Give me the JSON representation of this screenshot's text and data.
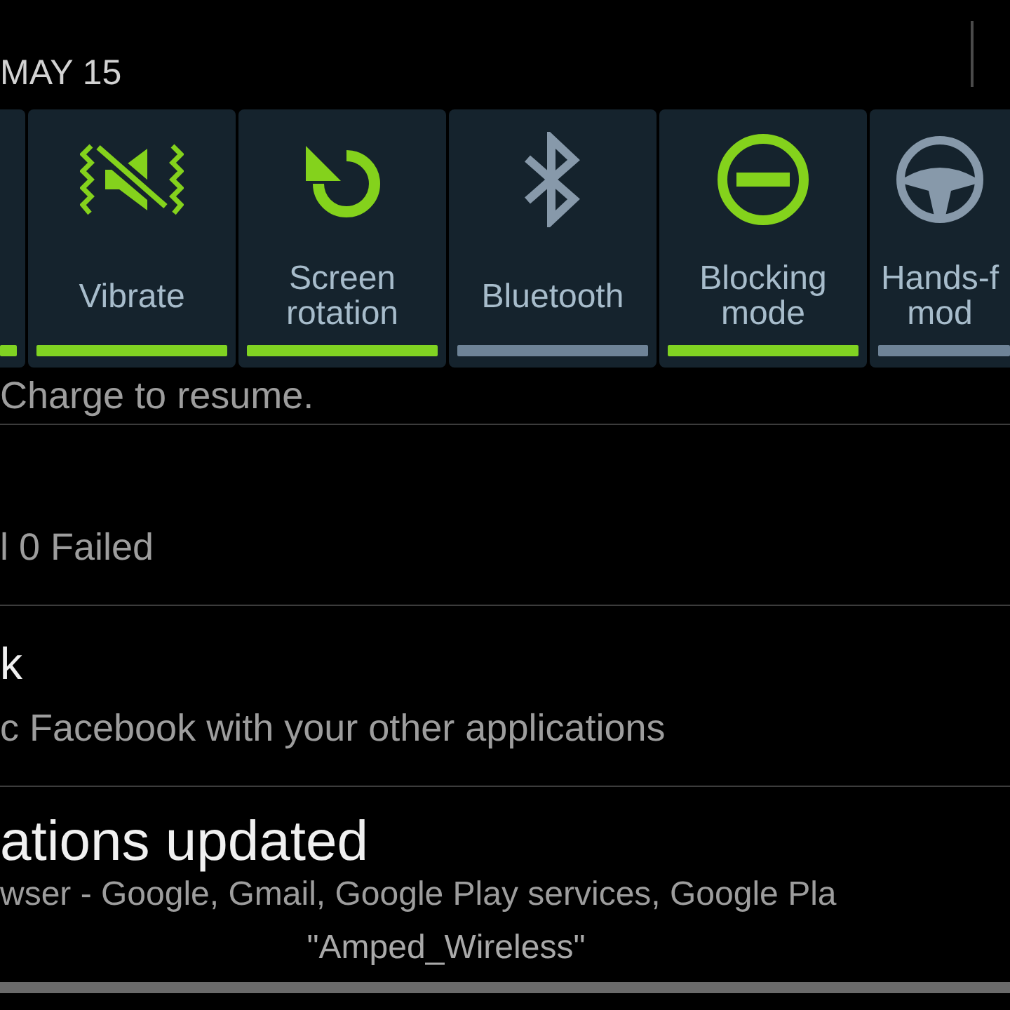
{
  "header": {
    "date": "MAY 15"
  },
  "quick_settings": [
    {
      "on": true
    },
    {
      "kind": "vibrate",
      "label": "Vibrate",
      "on": true
    },
    {
      "kind": "rotation",
      "label": "Screen rotation",
      "on": true
    },
    {
      "kind": "bluetooth",
      "label": "Bluetooth",
      "on": false
    },
    {
      "kind": "blocking",
      "label": "Blocking mode",
      "on": true
    },
    {
      "kind": "handsfree",
      "label": "Hands-f mod",
      "on": false
    }
  ],
  "notifications": [
    {
      "text": "Charge to resume."
    },
    {
      "text": "l 0 Failed"
    },
    {
      "title": "k",
      "text": "c Facebook with your other applications"
    },
    {
      "title": "ations updated",
      "text": "wser - Google, Gmail, Google Play services, Google Pla"
    }
  ],
  "status": {
    "network": "\"Amped_Wireless\""
  }
}
